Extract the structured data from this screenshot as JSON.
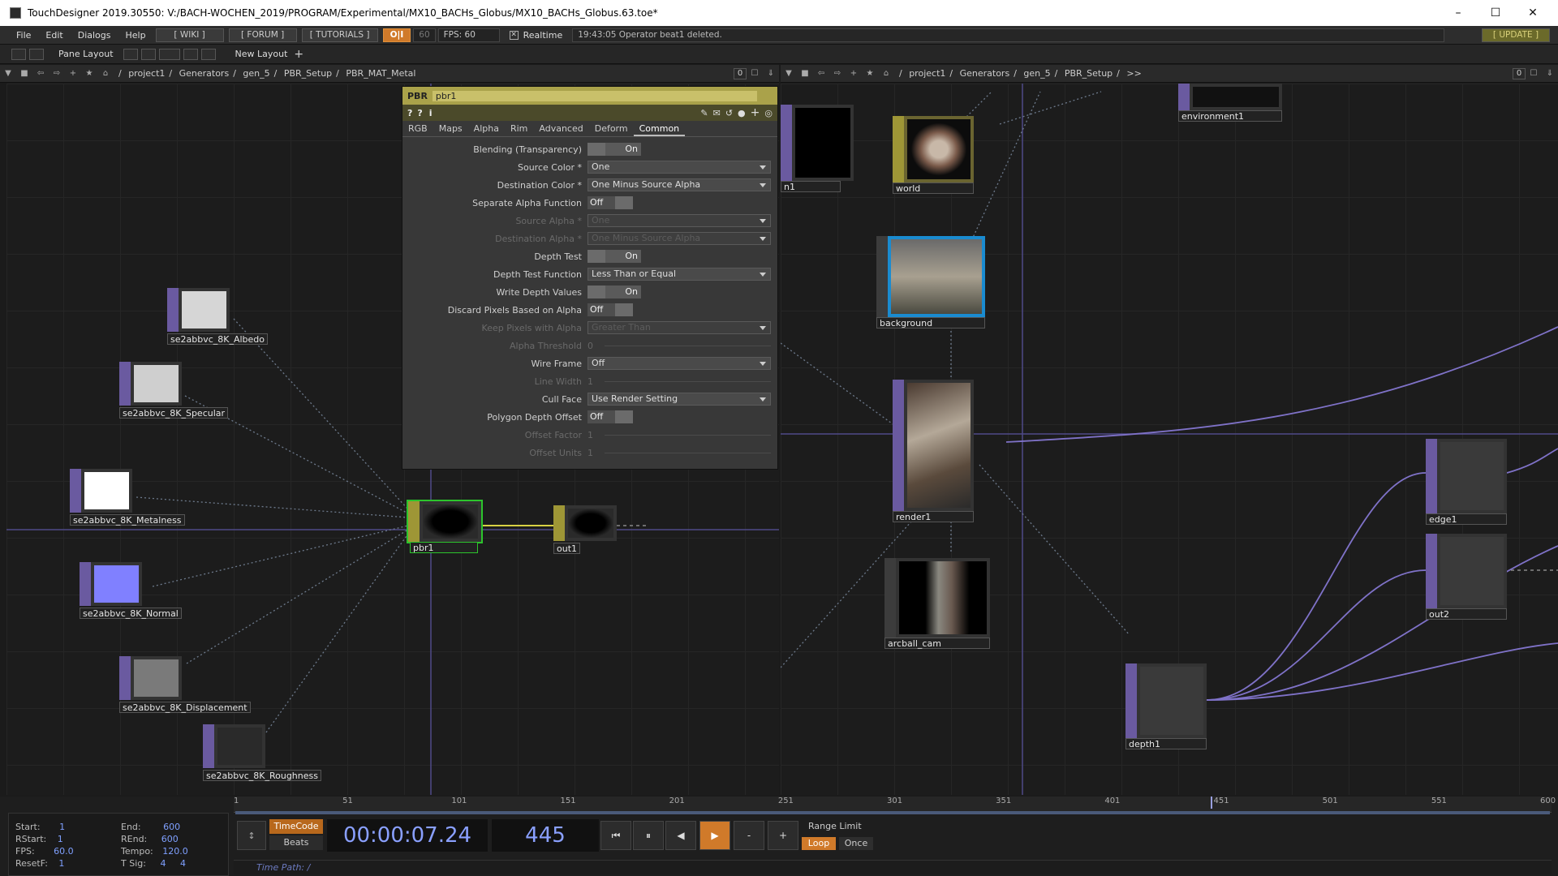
{
  "window": {
    "title": "TouchDesigner 2019.30550: V:/BACH-WOCHEN_2019/PROGRAM/Experimental/MX10_BACHs_Globus/MX10_BACHs_Globus.63.toe*",
    "minimize": "–",
    "maximize": "☐",
    "close": "✕"
  },
  "menubar": {
    "items": [
      "File",
      "Edit",
      "Dialogs",
      "Help"
    ],
    "wiki": "[ WIKI ]",
    "forum": "[ FORUM ]",
    "tutorials": "[ TUTORIALS ]",
    "oi": "O|I",
    "fps_cap": "60",
    "fps": "FPS:  60",
    "realtime": "Realtime",
    "message": "19:43:05 Operator beat1 deleted.",
    "update": "[ UPDATE ]"
  },
  "layoutbar": {
    "pane_layout": "Pane Layout",
    "new_layout": "New Layout"
  },
  "pane_left": {
    "path": [
      "project1",
      "Generators",
      "gen_5",
      "PBR_Setup",
      "PBR_MAT_Metal"
    ],
    "zero": "0"
  },
  "pane_right": {
    "path": [
      "project1",
      "Generators",
      "gen_5",
      "PBR_Setup",
      ">>"
    ],
    "zero": "0"
  },
  "param": {
    "type": "PBR",
    "name": "pbr1",
    "tabs": [
      "RGB",
      "Maps",
      "Alpha",
      "Rim",
      "Advanced",
      "Deform",
      "Common"
    ],
    "active_tab": "Common",
    "rows": [
      {
        "label": "Blending (Transparency)",
        "kind": "toggle",
        "value": "On"
      },
      {
        "label": "Source Color *",
        "kind": "menu",
        "value": "One"
      },
      {
        "label": "Destination Color *",
        "kind": "menu",
        "value": "One Minus Source Alpha"
      },
      {
        "label": "Separate Alpha Function",
        "kind": "toggle",
        "value": "Off"
      },
      {
        "label": "Source Alpha *",
        "kind": "menu",
        "value": "One",
        "dim": true
      },
      {
        "label": "Destination Alpha *",
        "kind": "menu",
        "value": "One Minus Source Alpha",
        "dim": true
      },
      {
        "label": "Depth Test",
        "kind": "toggle",
        "value": "On"
      },
      {
        "label": "Depth Test Function",
        "kind": "menu",
        "value": "Less Than or Equal"
      },
      {
        "label": "Write Depth Values",
        "kind": "toggle",
        "value": "On"
      },
      {
        "label": "Discard Pixels Based on Alpha",
        "kind": "toggle",
        "value": "Off"
      },
      {
        "label": "Keep Pixels with Alpha",
        "kind": "menu",
        "value": "Greater Than",
        "dim": true
      },
      {
        "label": "Alpha Threshold",
        "kind": "num",
        "value": "0",
        "dim": true
      },
      {
        "label": "Wire Frame",
        "kind": "menu",
        "value": "Off"
      },
      {
        "label": "Line Width",
        "kind": "num",
        "value": "1",
        "dim": true
      },
      {
        "label": "Cull Face",
        "kind": "menu",
        "value": "Use Render Setting"
      },
      {
        "label": "Polygon Depth Offset",
        "kind": "toggle",
        "value": "Off"
      },
      {
        "label": "Offset Factor",
        "kind": "num",
        "value": "1",
        "dim": true
      },
      {
        "label": "Offset Units",
        "kind": "num",
        "value": "1",
        "dim": true
      }
    ]
  },
  "nodes_left": [
    {
      "id": "albedo",
      "label": "se2abbvc_8K_Albedo",
      "color": "#d6d6d6"
    },
    {
      "id": "specular",
      "label": "se2abbvc_8K_Specular",
      "color": "#cfcfcf"
    },
    {
      "id": "metalness",
      "label": "se2abbvc_8K_Metalness",
      "color": "#ffffff"
    },
    {
      "id": "normal",
      "label": "se2abbvc_8K_Normal",
      "color": "#8080ff"
    },
    {
      "id": "displacement",
      "label": "se2abbvc_8K_Displacement",
      "color": "#7a7a7a"
    },
    {
      "id": "roughness",
      "label": "se2abbvc_8K_Roughness",
      "color": "#2a2a2a"
    },
    {
      "id": "pbr1",
      "label": "pbr1",
      "color": "#111111"
    },
    {
      "id": "out1",
      "label": "out1",
      "color": "#111111"
    }
  ],
  "nodes_right": {
    "n1": "n1",
    "world": "world",
    "background": "background",
    "render1": "render1",
    "arcball": "arcball_cam",
    "environment": "environment1",
    "edge": "edge1",
    "out2": "out2",
    "depth": "depth1"
  },
  "timeline": {
    "ticks": [
      "1",
      "51",
      "101",
      "151",
      "201",
      "251",
      "301",
      "351",
      "401",
      "451",
      "501",
      "551",
      "600"
    ],
    "start_k": "Start:",
    "start": "1",
    "end_k": "End:",
    "end": "600",
    "rstart_k": "RStart:",
    "rstart": "1",
    "rend_k": "REnd:",
    "rend": "600",
    "fps_k": "FPS:",
    "fps": "60.0",
    "tempo_k": "Tempo:",
    "tempo": "120.0",
    "reset_k": "ResetF:",
    "reset": "1",
    "tsig_k": "T Sig:",
    "tsig_a": "4",
    "tsig_b": "4",
    "timecode": "TimeCode",
    "beats": "Beats",
    "time": "00:00:07.24",
    "frame": "445",
    "range": "Range Limit",
    "loop": "Loop",
    "once": "Once",
    "timepath": "Time Path: /"
  }
}
